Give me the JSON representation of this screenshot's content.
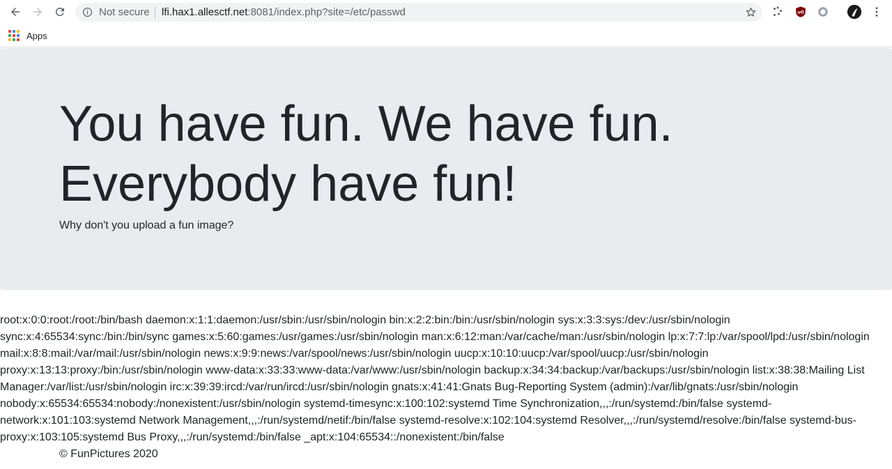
{
  "browser": {
    "security_status": "Not secure",
    "url_host": "lfi.hax1.allesctf.net",
    "url_rest": ":8081/index.php?site=/etc/passwd",
    "bookmarks": {
      "apps_label": "Apps"
    },
    "icons": {
      "back": "back-arrow-icon",
      "forward": "forward-arrow-icon",
      "reload": "reload-icon",
      "info": "info-icon",
      "star": "bookmark-star-icon",
      "menu": "kebab-menu-icon"
    }
  },
  "hero": {
    "title": "You have fun. We have fun. Everybody have fun!",
    "lead": "Why don't you upload a fun image?"
  },
  "content": {
    "passwd": "root:x:0:0:root:/root:/bin/bash daemon:x:1:1:daemon:/usr/sbin:/usr/sbin/nologin bin:x:2:2:bin:/bin:/usr/sbin/nologin sys:x:3:3:sys:/dev:/usr/sbin/nologin sync:x:4:65534:sync:/bin:/bin/sync games:x:5:60:games:/usr/games:/usr/sbin/nologin man:x:6:12:man:/var/cache/man:/usr/sbin/nologin lp:x:7:7:lp:/var/spool/lpd:/usr/sbin/nologin mail:x:8:8:mail:/var/mail:/usr/sbin/nologin news:x:9:9:news:/var/spool/news:/usr/sbin/nologin uucp:x:10:10:uucp:/var/spool/uucp:/usr/sbin/nologin proxy:x:13:13:proxy:/bin:/usr/sbin/nologin www-data:x:33:33:www-data:/var/www:/usr/sbin/nologin backup:x:34:34:backup:/var/backups:/usr/sbin/nologin list:x:38:38:Mailing List Manager:/var/list:/usr/sbin/nologin irc:x:39:39:ircd:/var/run/ircd:/usr/sbin/nologin gnats:x:41:41:Gnats Bug-Reporting System (admin):/var/lib/gnats:/usr/sbin/nologin nobody:x:65534:65534:nobody:/nonexistent:/usr/sbin/nologin systemd-timesync:x:100:102:systemd Time Synchronization,,,:/run/systemd:/bin/false systemd-network:x:101:103:systemd Network Management,,,:/run/systemd/netif:/bin/false systemd-resolve:x:102:104:systemd Resolver,,,:/run/systemd/resolve:/bin/false systemd-bus-proxy:x:103:105:systemd Bus Proxy,,,:/run/systemd:/bin/false _apt:x:104:65534::/nonexistent:/bin/false"
  },
  "footer": {
    "copyright": "© FunPictures 2020"
  },
  "colors": {
    "jumbotron_bg": "#e9ecef",
    "text": "#212529",
    "omnibox_bg": "#f1f3f4",
    "ublock_red": "#800000"
  }
}
